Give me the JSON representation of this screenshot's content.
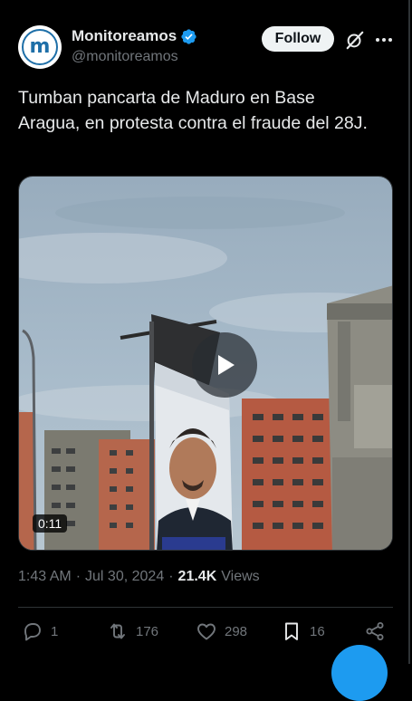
{
  "author": {
    "avatar_letter": "m",
    "name": "Monitoreamos",
    "handle": "@monitoreamos",
    "verified_icon": "verified-badge-icon"
  },
  "header": {
    "follow_label": "Follow",
    "icons": [
      "grok-icon",
      "more-icon"
    ]
  },
  "tweet": {
    "text": "Tumban pancarta de Maduro en Base Aragua, en protesta contra el fraude del 28J."
  },
  "media": {
    "type": "video",
    "duration": "0:11",
    "play_icon": "play-icon"
  },
  "meta": {
    "time": "1:43 AM",
    "date": "Jul 30, 2024",
    "views_count": "21.4K",
    "views_label": "Views",
    "separator": "·"
  },
  "actions": {
    "replies": "1",
    "reposts": "176",
    "likes": "298",
    "bookmarks": "16"
  },
  "colors": {
    "background": "#000000",
    "accent": "#1d9bf0",
    "muted_text": "#71767b",
    "primary_text": "#e7e9ea"
  }
}
